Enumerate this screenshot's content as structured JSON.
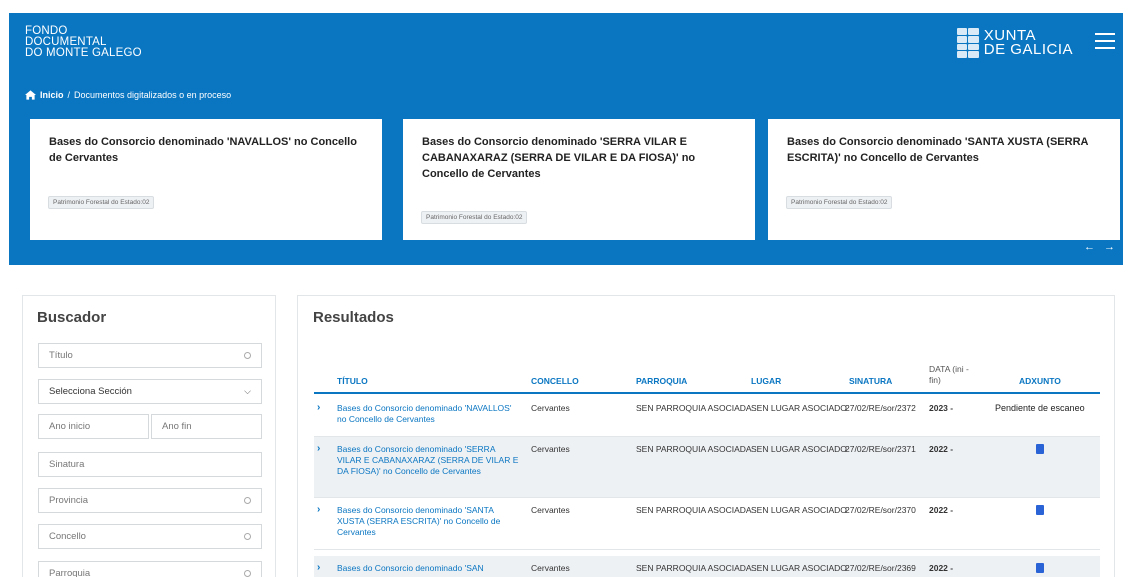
{
  "header": {
    "brand_lines": [
      "FONDO",
      "DOCUMENTAL",
      "DO MONTE GALEGO"
    ],
    "xunta_lines": [
      "XUNTA",
      "DE GALICIA"
    ],
    "accent_color": "#0a76c2"
  },
  "breadcrumb": {
    "home": "Inicio",
    "separator": "/",
    "current": "Documentos digitalizados o en proceso"
  },
  "cards": [
    {
      "title": "Bases do Consorcio denominado 'NAVALLOS' no Concello de Cervantes",
      "tag": "Patrimonio Forestal do Estado:02"
    },
    {
      "title": "Bases do Consorcio denominado 'SERRA VILAR E CABANAXARAZ (SERRA DE VILAR E DA FIOSA)' no Concello de Cervantes",
      "tag": "Patrimonio Forestal do Estado:02"
    },
    {
      "title": "Bases do Consorcio denominado 'SANTA XUSTA (SERRA ESCRITA)' no Concello de Cervantes",
      "tag": "Patrimonio Forestal do Estado:02"
    }
  ],
  "carousel": {
    "prev": "←",
    "next": "→"
  },
  "search": {
    "title": "Buscador",
    "titulo_placeholder": "Título",
    "seccion_label": "Selecciona Sección",
    "ano_inicio": "Ano inicio",
    "ano_fin": "Ano fin",
    "sinatura": "Sinatura",
    "provincia": "Provincia",
    "concello": "Concello",
    "parroquia": "Parroquia"
  },
  "results": {
    "title": "Resultados",
    "columns": {
      "titulo": "TÍTULO",
      "concello": "CONCELLO",
      "parroquia": "PARROQUIA",
      "lugar": "LUGAR",
      "sinatura": "SINATURA",
      "data_line1": "DATA (ini -",
      "data_line2": "fin)",
      "adxunto": "ADXUNTO"
    },
    "rows": [
      {
        "title_lines": [
          "Bases do Consorcio denominado 'NAVALLOS'",
          "no Concello de Cervantes"
        ],
        "concello": "Cervantes",
        "parroquia": "SEN PARROQUIA ASOCIADA",
        "lugar": "SEN LUGAR ASOCIADO",
        "sinatura": "27/02/RE/sor/2372",
        "data": "2023 -",
        "adxunto": "Pendiente de escaneo"
      },
      {
        "title_lines": [
          "Bases do Consorcio denominado 'SERRA",
          "VILAR E CABANAXARAZ (SERRA DE VILAR E",
          "DA FIOSA)' no Concello de Cervantes"
        ],
        "concello": "Cervantes",
        "parroquia": "SEN PARROQUIA ASOCIADA",
        "lugar": "SEN LUGAR ASOCIADO",
        "sinatura": "27/02/RE/sor/2371",
        "data": "2022 -",
        "adxunto": "pdf-icon"
      },
      {
        "title_lines": [
          "Bases do Consorcio denominado 'SANTA",
          "XUSTA (SERRA ESCRITA)' no Concello de",
          "Cervantes"
        ],
        "concello": "Cervantes",
        "parroquia": "SEN PARROQUIA ASOCIADA",
        "lugar": "SEN LUGAR ASOCIADO",
        "sinatura": "27/02/RE/sor/2370",
        "data": "2022 -",
        "adxunto": "pdf-icon"
      },
      {
        "title_lines": [
          "Bases do Consorcio denominado 'SAN"
        ],
        "concello": "Cervantes",
        "parroquia": "SEN PARROQUIA ASOCIADA",
        "lugar": "SEN LUGAR ASOCIADO",
        "sinatura": "27/02/RE/sor/2369",
        "data": "2022 -",
        "adxunto": "pdf-icon"
      }
    ]
  }
}
